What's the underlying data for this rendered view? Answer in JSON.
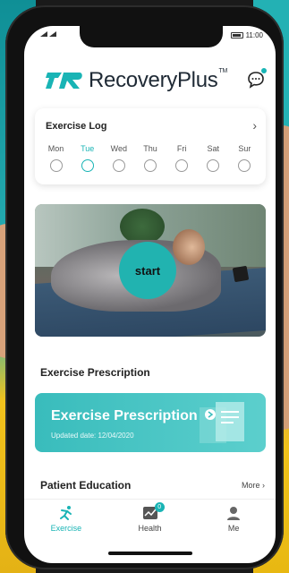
{
  "status_bar": {
    "time": "11:00",
    "battery_icon": "battery-icon",
    "signal_icon": "signal-icon"
  },
  "header": {
    "brand_name": "RecoveryPlus",
    "brand_mark": "TM",
    "chat_icon": "chat-bubble-icon"
  },
  "exercise_log": {
    "title": "Exercise Log",
    "chevron": "›",
    "days": [
      {
        "label": "Mon",
        "active": false
      },
      {
        "label": "Tue",
        "active": true
      },
      {
        "label": "Wed",
        "active": false
      },
      {
        "label": "Thu",
        "active": false
      },
      {
        "label": "Fri",
        "active": false
      },
      {
        "label": "Sat",
        "active": false
      },
      {
        "label": "Sur",
        "active": false
      }
    ]
  },
  "video": {
    "start_label": "start"
  },
  "prescription": {
    "section_title": "Exercise Prescription",
    "card_title": "Exercise Prescription",
    "updated_text": "Updated date: 12/04/2020"
  },
  "patient_education": {
    "section_title": "Patient Education",
    "more_label": "More"
  },
  "tabbar": {
    "tabs": [
      {
        "label": "Exercise",
        "icon": "exercise-icon",
        "active": true
      },
      {
        "label": "Health",
        "icon": "health-chart-icon",
        "active": false,
        "badge": "0"
      },
      {
        "label": "Me",
        "icon": "profile-icon",
        "active": false
      }
    ]
  },
  "colors": {
    "accent": "#19b4b5",
    "text": "#222222"
  }
}
